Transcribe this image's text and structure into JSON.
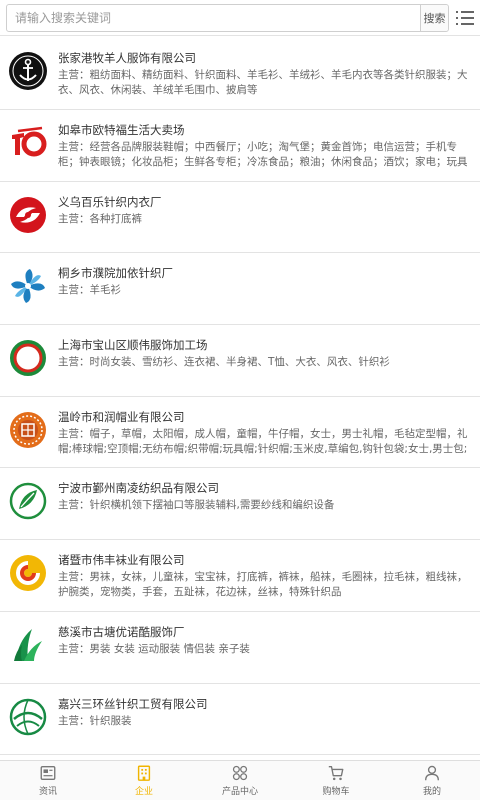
{
  "search": {
    "placeholder": "请输入搜索关键词",
    "button_label": "搜索"
  },
  "header": {
    "menu_icon": "list-menu-icon"
  },
  "companies": [
    {
      "name": "张家港牧羊人服饰有限公司",
      "desc": "主营：粗纺面料、精纺面料、针织面料、羊毛衫、羊绒衫、羊毛内衣等各类针织服装；大衣、风衣、休闲装、羊绒羊毛围巾、披肩等",
      "logo_icon": "anchor-logo-icon"
    },
    {
      "name": "如皋市欧特福生活大卖场",
      "desc": "主营：经营各品牌服装鞋帽；中西餐厅；小吃；淘气堡；黄金首饰；电信运营；手机专柜；钟表眼镜；化妆品柜；生鲜各专柜；冷冻食品；粮油；休闲食品；酒饮；家电；玩具家用家纺；服装鞋帽；床上用品",
      "logo_icon": "number-10-logo-icon"
    },
    {
      "name": "义乌百乐针织内衣厂",
      "desc": "主营：各种打底裤",
      "logo_icon": "red-swirl-logo-icon"
    },
    {
      "name": "桐乡市濮院加依针织厂",
      "desc": "主营：羊毛衫",
      "logo_icon": "blue-pinwheel-logo-icon"
    },
    {
      "name": "上海市宝山区顺伟服饰加工场",
      "desc": "主营：时尚女装、雪纺衫、连衣裙、半身裙、T恤、大衣、风衣、针织衫",
      "logo_icon": "ring-logo-icon"
    },
    {
      "name": "温岭市和润帽业有限公司",
      "desc": "主营：帽子，草帽，太阳帽，成人帽，童帽，牛仔帽，女士，男士礼帽，毛毡定型帽，礼帽;棒球帽;空顶帽;无纺布帽;织带帽;玩具帽;针织帽;玉米皮,草编包,钩针包袋;女士,男士包;手工加工;各种手编草帽子;帽坯;餐垫;工艺",
      "logo_icon": "seal-logo-icon"
    },
    {
      "name": "宁波市鄞州南凌纺织品有限公司",
      "desc": "主营：针织横机领下摆袖口等服装辅料,需要纱线和编织设备",
      "logo_icon": "green-leaf-logo-icon"
    },
    {
      "name": "诸暨市伟丰袜业有限公司",
      "desc": "主营：男袜，女袜，儿童袜，宝宝袜，打底裤，裤袜，船袜，毛圈袜，拉毛袜，粗线袜，护腕类，宠物类，手套，五趾袜，花边袜，丝袜，特殊针织品",
      "logo_icon": "yellow-swirl-logo-icon"
    },
    {
      "name": "慈溪市古塘优诺酷服饰厂",
      "desc": "主营：男装 女装 运动服装 情侣装 亲子装",
      "logo_icon": "green-plant-logo-icon"
    },
    {
      "name": "嘉兴三环丝针织工贸有限公司",
      "desc": "主营：针织服装",
      "logo_icon": "globe-logo-icon"
    }
  ],
  "tabbar": [
    {
      "label": "资讯",
      "icon": "news-icon",
      "active": false
    },
    {
      "label": "企业",
      "icon": "building-icon",
      "active": true
    },
    {
      "label": "产品中心",
      "icon": "grid-icon",
      "active": false
    },
    {
      "label": "购物车",
      "icon": "cart-icon",
      "active": false
    },
    {
      "label": "我的",
      "icon": "user-icon",
      "active": false
    }
  ],
  "colors": {
    "accent": "#f0b400",
    "border": "#e3e3e3",
    "text": "#333333",
    "muted": "#666666"
  }
}
